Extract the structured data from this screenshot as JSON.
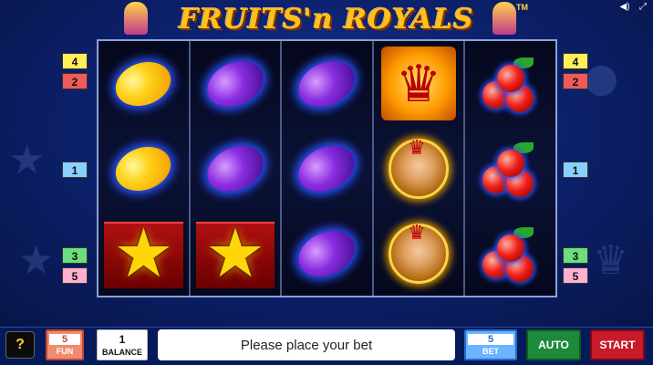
{
  "game": {
    "title": "FRUITS'n ROYALS",
    "trademark": "TM"
  },
  "system_icons": [
    "volume-icon",
    "fullscreen-icon"
  ],
  "reels": [
    [
      "lemon",
      "lemon",
      "star"
    ],
    [
      "plum",
      "plum",
      "star"
    ],
    [
      "plum",
      "plum",
      "plum"
    ],
    [
      "crown",
      "queen",
      "queen"
    ],
    [
      "cherries",
      "cherries",
      "cherries"
    ]
  ],
  "paylines": {
    "left": [
      "4",
      "2",
      "1",
      "3",
      "5"
    ],
    "right": [
      "4",
      "2",
      "1",
      "3",
      "5"
    ]
  },
  "controls": {
    "help_label": "?",
    "fun_value": "5",
    "fun_label": "FUN",
    "balance_value": "1",
    "balance_label": "BALANCE",
    "message": "Please place your bet",
    "bet_value": "5",
    "bet_label": "BET",
    "auto_label": "AUTO",
    "start_label": "START"
  },
  "colors": {
    "background": "#0d2270",
    "accent_gold": "#ffc21a",
    "start_red": "#c81a2a",
    "auto_green": "#1c8a3a",
    "bet_blue": "#6ab4ff"
  }
}
